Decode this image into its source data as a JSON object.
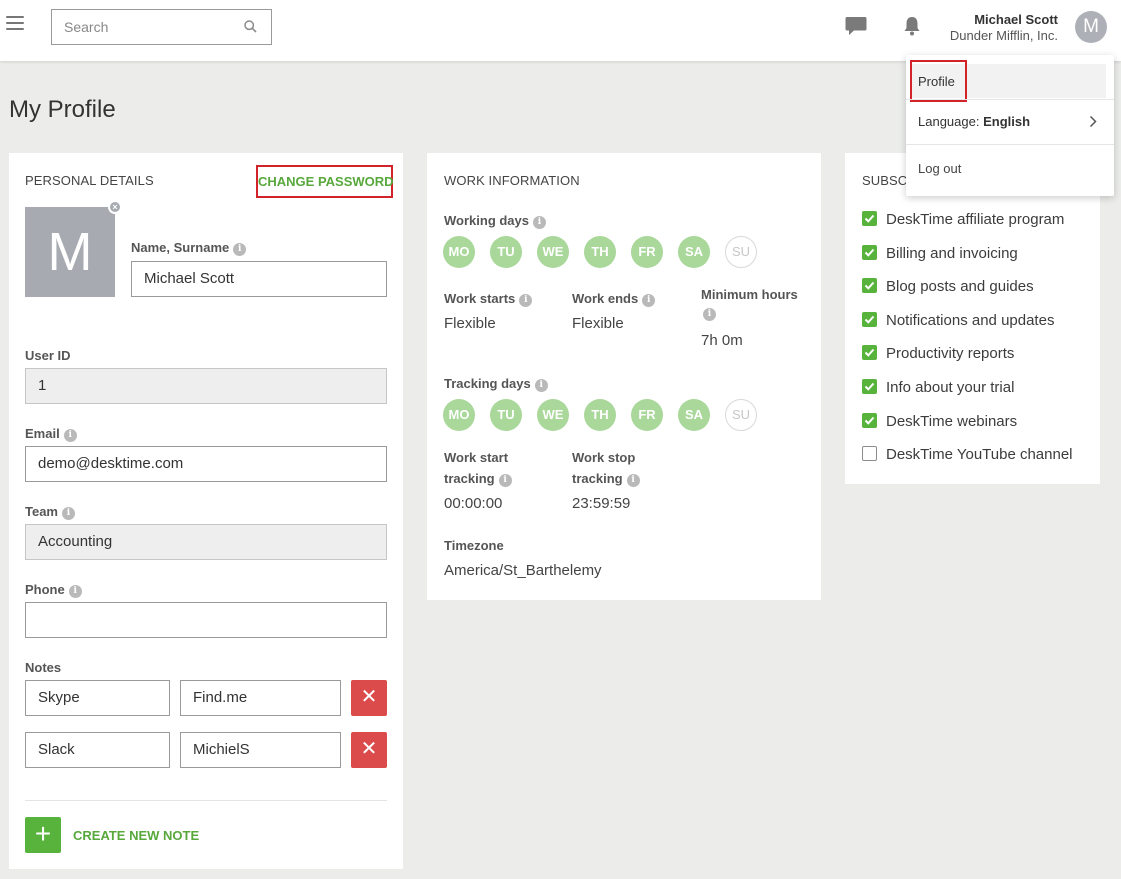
{
  "header": {
    "search_placeholder": "Search",
    "user_name": "Michael Scott",
    "company": "Dunder Mifflin, Inc.",
    "avatar_initial": "M"
  },
  "page": {
    "title": "My Profile"
  },
  "personal": {
    "title": "PERSONAL DETAILS",
    "change_password": "CHANGE PASSWORD",
    "avatar_initial": "M",
    "name_label": "Name, Surname",
    "name_value": "Michael Scott",
    "userid_label": "User ID",
    "userid_value": "1",
    "email_label": "Email",
    "email_value": "demo@desktime.com",
    "team_label": "Team",
    "team_value": "Accounting",
    "phone_label": "Phone",
    "phone_value": "",
    "notes_label": "Notes",
    "notes": [
      {
        "key": "Skype",
        "value": "Find.me"
      },
      {
        "key": "Slack",
        "value": "MichielS"
      }
    ],
    "create_note": "CREATE NEW NOTE"
  },
  "work": {
    "title": "WORK INFORMATION",
    "working_days_label": "Working days",
    "days": [
      {
        "label": "MO",
        "active": true
      },
      {
        "label": "TU",
        "active": true
      },
      {
        "label": "WE",
        "active": true
      },
      {
        "label": "TH",
        "active": true
      },
      {
        "label": "FR",
        "active": true
      },
      {
        "label": "SA",
        "active": true
      },
      {
        "label": "SU",
        "active": false
      }
    ],
    "work_starts_label": "Work starts",
    "work_starts_value": "Flexible",
    "work_ends_label": "Work ends",
    "work_ends_value": "Flexible",
    "min_hours_label": "Minimum hours",
    "min_hours_value": "7h 0m",
    "tracking_days_label": "Tracking days",
    "tracking_days": [
      {
        "label": "MO",
        "active": true
      },
      {
        "label": "TU",
        "active": true
      },
      {
        "label": "WE",
        "active": true
      },
      {
        "label": "TH",
        "active": true
      },
      {
        "label": "FR",
        "active": true
      },
      {
        "label": "SA",
        "active": true
      },
      {
        "label": "SU",
        "active": false
      }
    ],
    "start_tracking_label_1": "Work start",
    "start_tracking_label_2": "tracking",
    "start_tracking_value": "00:00:00",
    "stop_tracking_label_1": "Work stop",
    "stop_tracking_label_2": "tracking",
    "stop_tracking_value": "23:59:59",
    "timezone_label": "Timezone",
    "timezone_value": "America/St_Barthelemy"
  },
  "subscriptions": {
    "title": "SUBSCR",
    "items": [
      {
        "label": "DeskTime affiliate program",
        "checked": true
      },
      {
        "label": "Billing and invoicing",
        "checked": true
      },
      {
        "label": "Blog posts and guides",
        "checked": true
      },
      {
        "label": "Notifications and updates",
        "checked": true
      },
      {
        "label": "Productivity reports",
        "checked": true
      },
      {
        "label": "Info about your trial",
        "checked": true
      },
      {
        "label": "DeskTime webinars",
        "checked": true
      },
      {
        "label": "DeskTime YouTube channel",
        "checked": false
      }
    ]
  },
  "dropdown": {
    "profile": "Profile",
    "language_prefix": "Language:",
    "language_value": "English",
    "logout": "Log out"
  },
  "colors": {
    "accent_green": "#58a83c",
    "day_active": "#a9d89a",
    "danger": "#dc4b4b",
    "highlight_red": "#d2232a"
  }
}
